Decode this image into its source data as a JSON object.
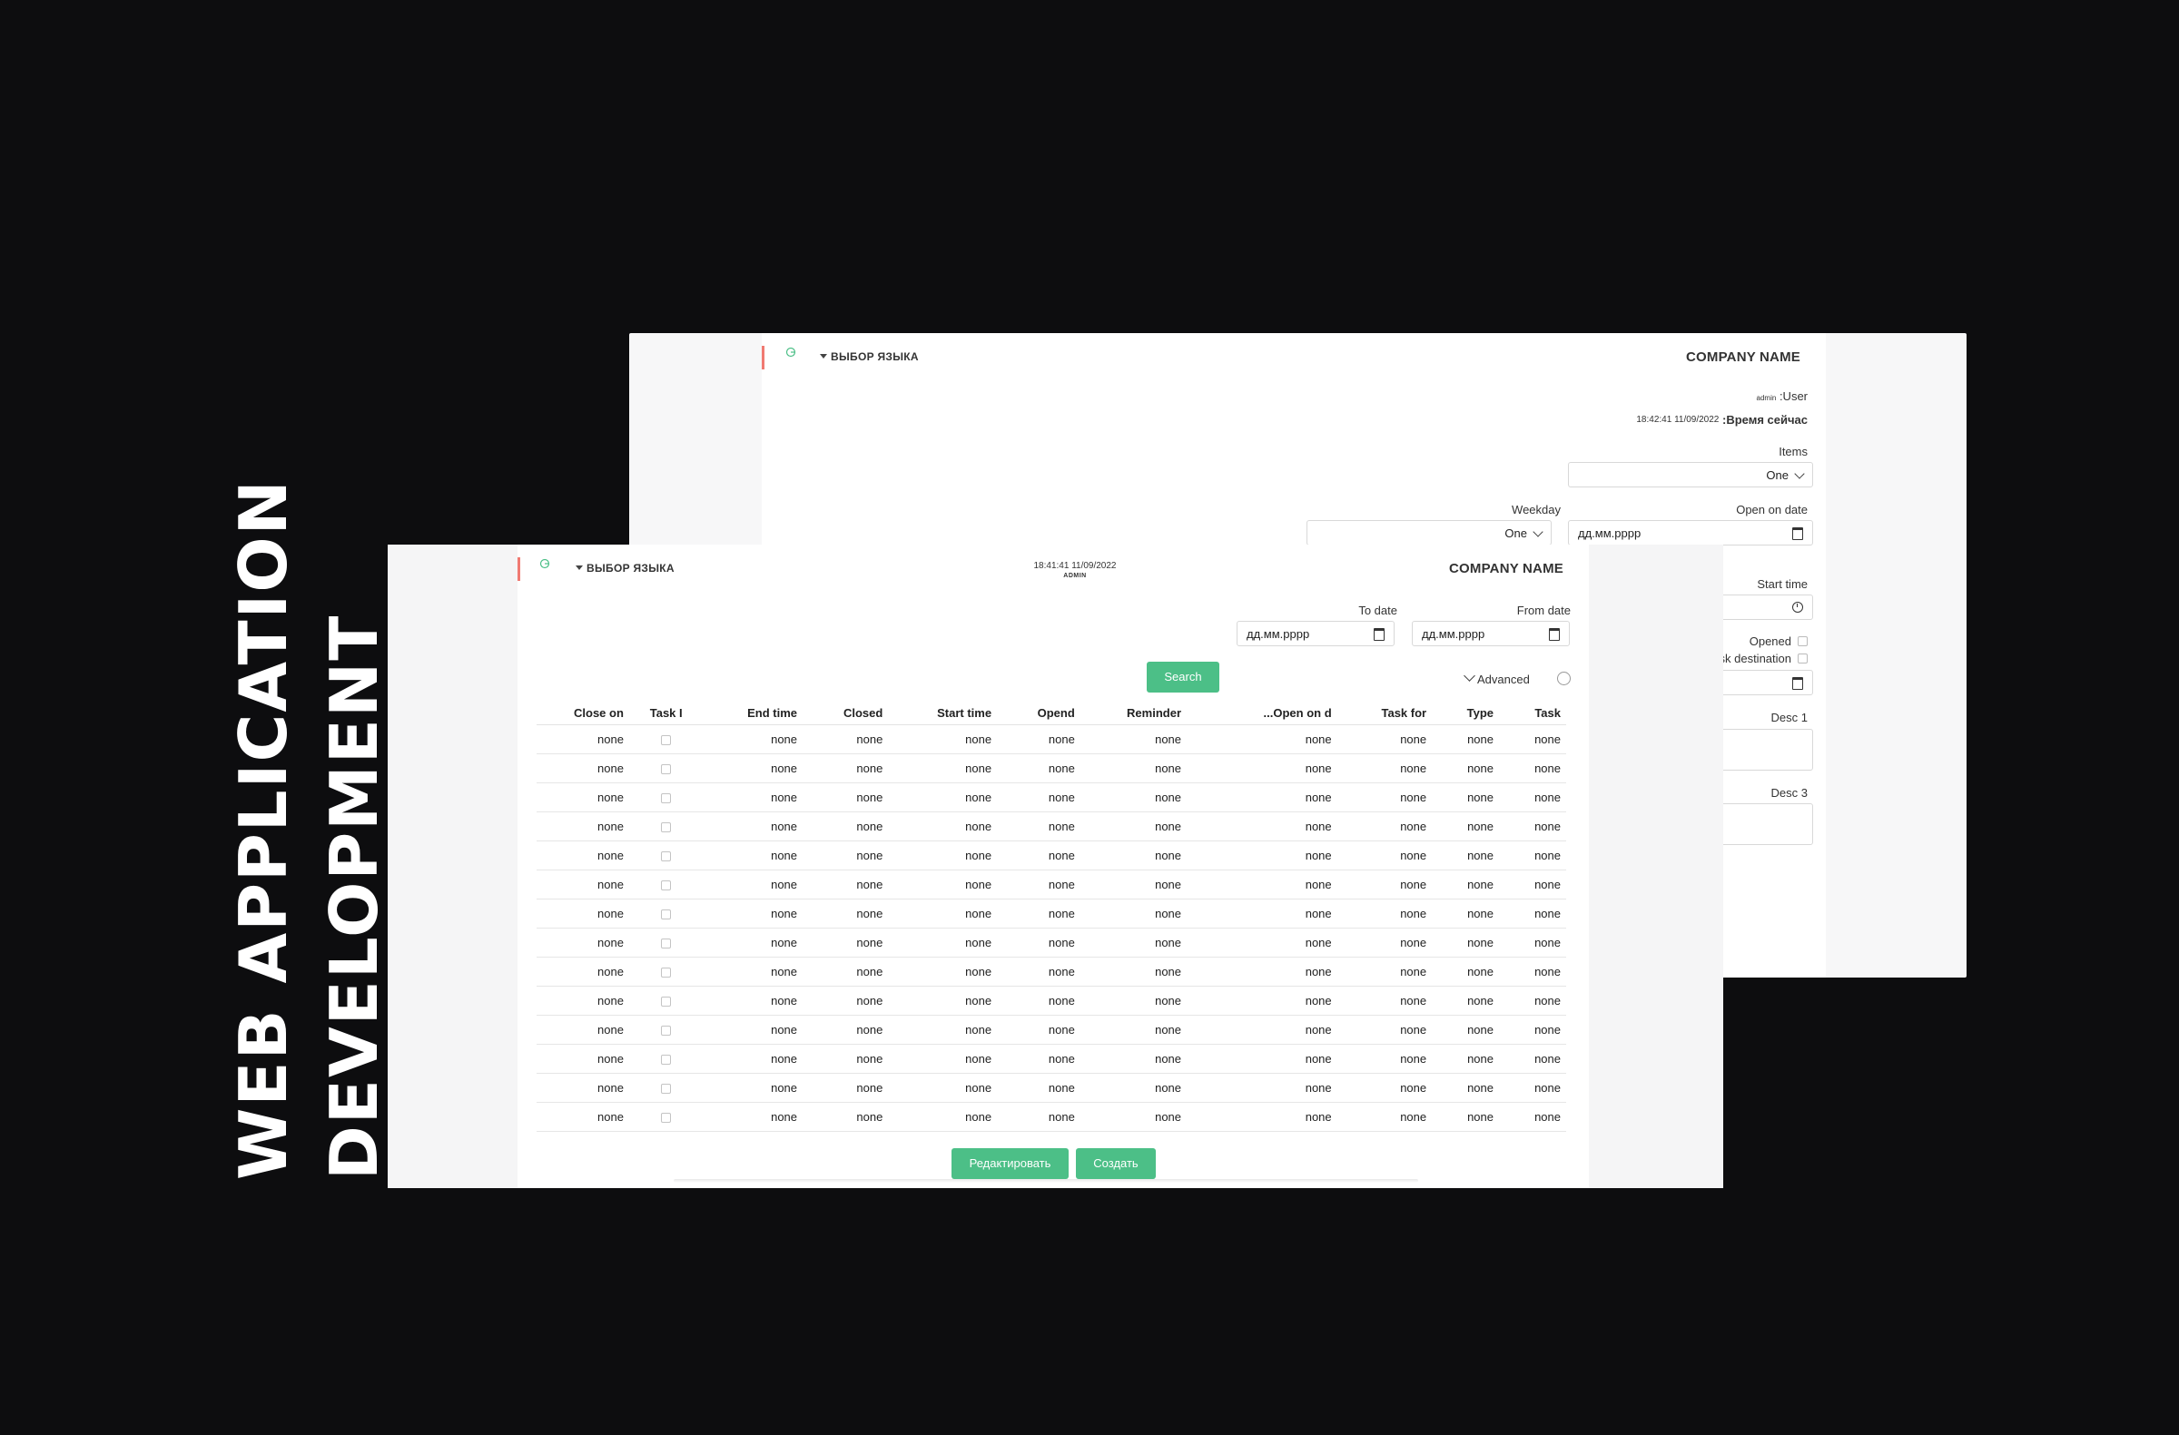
{
  "headline": {
    "line1": "WEB APPLICATION",
    "line2": "DEVELOPMENT"
  },
  "back_window": {
    "language_label": "ВЫБОР ЯЗЫКА",
    "company": "COMPANY NAME",
    "user_label": ":User",
    "user_value": "admin",
    "time_label": ":Время сейчас",
    "time_value": "18:42:41 11/09/2022",
    "items_label": "Items",
    "items_value": "One",
    "weekday_label": "Weekday",
    "weekday_value": "One",
    "open_on_date_label": "Open on date",
    "open_on_date_placeholder": "дд.мм.рррр",
    "start_time_label": "Start time",
    "opened_label": "Opened",
    "task_destination_label": "ask destination",
    "desc1_label": "Desc 1",
    "desc3_label": "Desc 3"
  },
  "front_window": {
    "language_label": "ВЫБОР ЯЗЫКА",
    "company": "COMPANY NAME",
    "datetime": "18:41:41 11/09/2022",
    "user": "ADMIN",
    "to_date_label": "To date",
    "to_date_placeholder": "дд.мм.рррр",
    "from_date_label": "From date",
    "from_date_placeholder": "дд.мм.рррр",
    "search_label": "Search",
    "advanced_label": "Advanced",
    "edit_label": "Редактировать",
    "create_label": "Создать",
    "table": {
      "headers": [
        "Close on",
        "Task I",
        "End time",
        "Closed",
        "Start time",
        "Opend",
        "Reminder",
        "...Open on d",
        "Task for",
        "Type",
        "Task"
      ],
      "cell_value": "none",
      "rows": 14
    }
  },
  "colors": {
    "accent_green": "#4cbf87",
    "accent_red": "#f07a72",
    "background": "#0d0d0f"
  }
}
